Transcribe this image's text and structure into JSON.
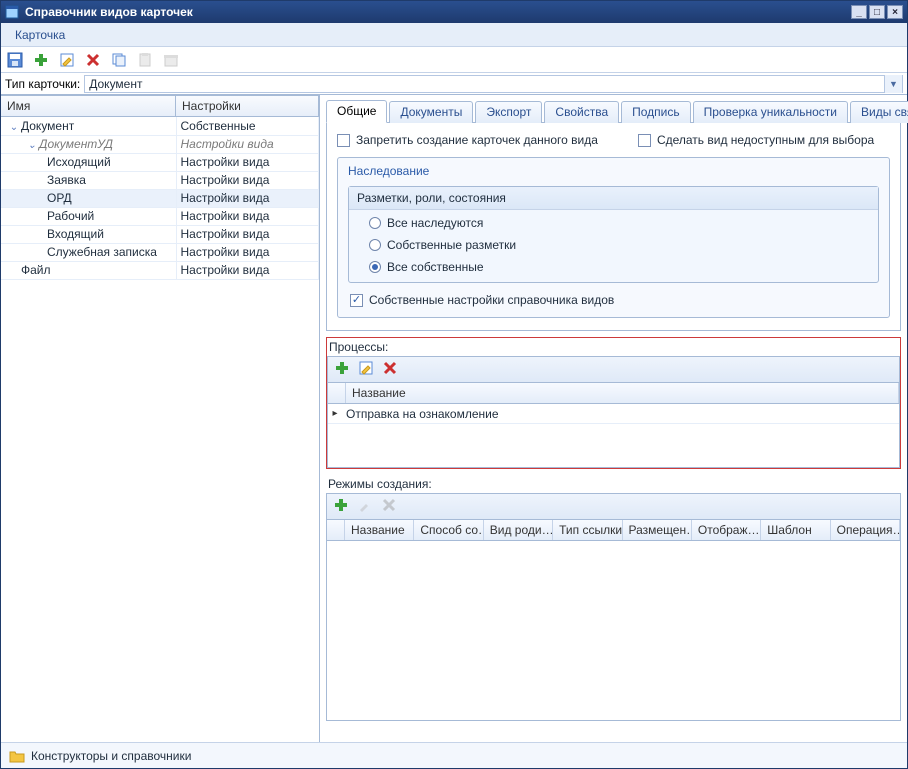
{
  "window": {
    "title": "Справочник видов карточек"
  },
  "menu": {
    "card": "Карточка"
  },
  "cardType": {
    "label": "Тип карточки:",
    "value": "Документ"
  },
  "tree": {
    "columns": {
      "name": "Имя",
      "settings": "Настройки"
    },
    "rows": [
      {
        "name": "Документ",
        "settings": "Собственные"
      },
      {
        "name": "ДокументУД",
        "settings": "Настройки вида"
      },
      {
        "name": "Исходящий",
        "settings": "Настройки вида"
      },
      {
        "name": "Заявка",
        "settings": "Настройки вида"
      },
      {
        "name": "ОРД",
        "settings": "Настройки вида"
      },
      {
        "name": "Рабочий",
        "settings": "Настройки вида"
      },
      {
        "name": "Входящий",
        "settings": "Настройки вида"
      },
      {
        "name": "Служебная записка",
        "settings": "Настройки вида"
      },
      {
        "name": "Файл",
        "settings": "Настройки вида"
      }
    ]
  },
  "tabs": [
    "Общие",
    "Документы",
    "Экспорт",
    "Свойства",
    "Подпись",
    "Проверка уникальности",
    "Виды связанных з"
  ],
  "general": {
    "chkDisallowCreate": "Запретить создание карточек данного вида",
    "chkHideFromSelect": "Сделать вид недоступным для выбора",
    "inheritance": {
      "title": "Наследование",
      "subTitle": "Разметки, роли, состояния",
      "options": [
        "Все наследуются",
        "Собственные разметки",
        "Все собственные"
      ],
      "selected": 2,
      "ownDirSettings": "Собственные настройки справочника видов",
      "ownDirSettingsChecked": true
    }
  },
  "processes": {
    "label": "Процессы:",
    "columns": [
      "Название"
    ],
    "rows": [
      "Отправка на ознакомление"
    ]
  },
  "modes": {
    "label": "Режимы создания:",
    "columns": [
      "Название",
      "Способ со…",
      "Вид роди…",
      "Тип ссылки",
      "Размещен…",
      "Отображ…",
      "Шаблон",
      "Операция…"
    ],
    "rows": []
  },
  "status": {
    "text": "Конструкторы и справочники"
  },
  "colors": {
    "accent": "#2a5aa8",
    "border": "#a6bad6",
    "highlight": "#eaf1fb",
    "error": "#cc3a3a"
  }
}
